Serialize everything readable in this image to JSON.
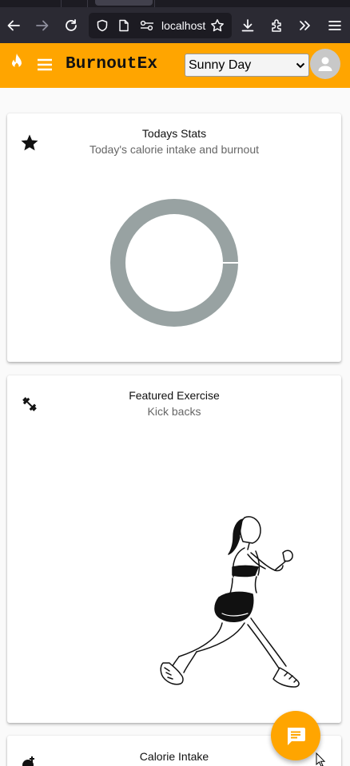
{
  "browser": {
    "url": "localhost",
    "icons": [
      "back-arrow-icon",
      "forward-arrow-icon",
      "reload-icon",
      "shield-icon",
      "page-icon",
      "permissions-icon",
      "bookmark-star-icon",
      "download-icon",
      "extensions-icon",
      "overflow-chevrons-icon",
      "hamburger-menu-icon"
    ]
  },
  "header": {
    "title": "BurnoutEx",
    "theme_selected": "Sunny Day",
    "accent_color": "#ffa500"
  },
  "stats_card": {
    "title": "Todays Stats",
    "subtitle": "Today's calorie intake and burnout",
    "ring_color": "#98a2a2"
  },
  "exercise_card": {
    "title": "Featured Exercise",
    "subtitle": "Kick backs"
  },
  "intake_card": {
    "title": "Calorie Intake"
  }
}
